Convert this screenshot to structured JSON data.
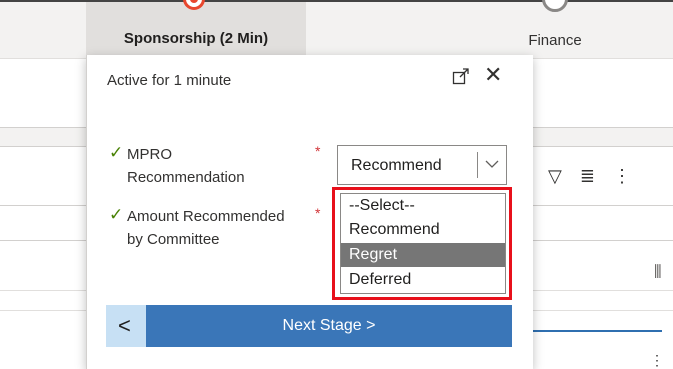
{
  "stages": {
    "active": {
      "label": "Sponsorship  (2 Min)"
    },
    "next": {
      "label": "Finance"
    }
  },
  "panel": {
    "status": "Active for 1 minute",
    "fields": [
      {
        "label": "MPRO Recommendation",
        "required_mark": "*",
        "value": "Recommend"
      },
      {
        "label": "Amount Recommended by Committee",
        "required_mark": "*"
      }
    ],
    "dropdown": {
      "options": [
        "--Select--",
        "Recommend",
        "Regret",
        "Deferred"
      ],
      "highlighted": "Regret"
    },
    "footer": {
      "next_label": "Next Stage  >",
      "back_icon": "<"
    }
  },
  "colors": {
    "active_stage": "#e8472e",
    "next_button": "#3a76b8",
    "back_button": "#c7e0f4",
    "check": "#498205",
    "required": "#d13438",
    "highlight_box": "#e8101b"
  }
}
